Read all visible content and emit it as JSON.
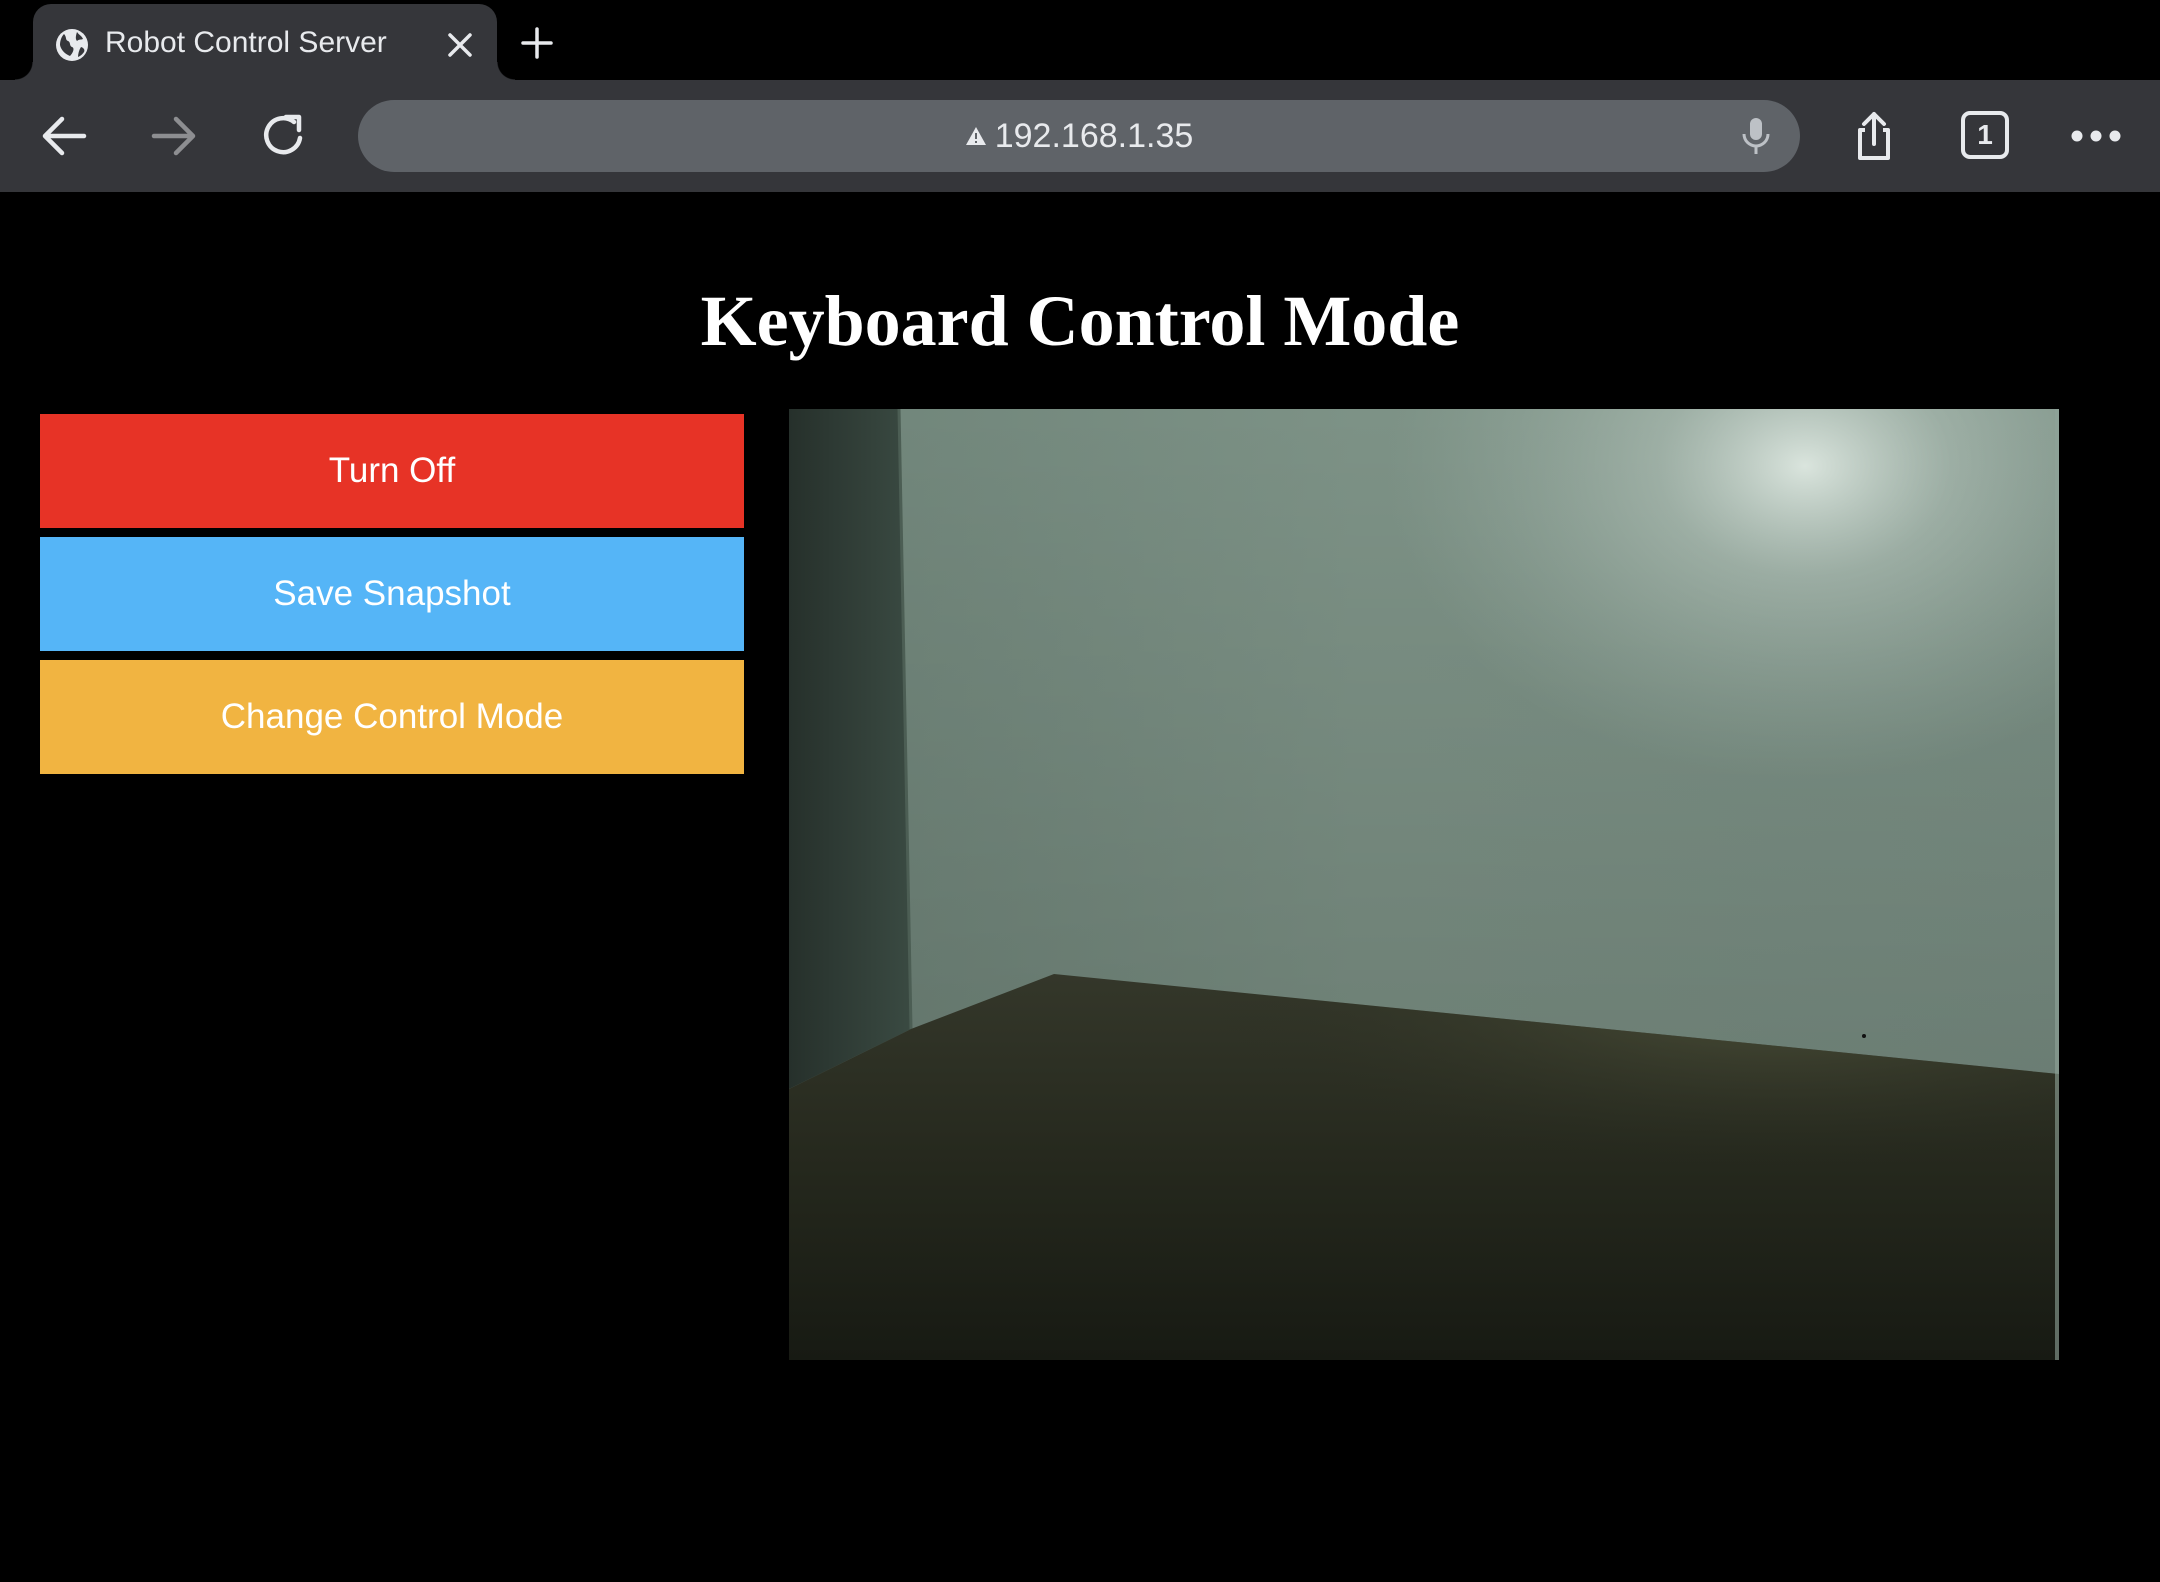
{
  "browser": {
    "tab": {
      "title": "Robot Control Server",
      "favicon_icon": "globe-icon",
      "close_icon": "close-icon"
    },
    "new_tab_icon": "plus-icon",
    "toolbar": {
      "back_icon": "back-arrow-icon",
      "forward_icon": "forward-arrow-icon",
      "reload_icon": "reload-icon",
      "url": "192.168.1.35",
      "security_icon": "warning-triangle-icon",
      "mic_icon": "microphone-icon",
      "share_icon": "share-icon",
      "tab_count": "1",
      "menu_icon": "more-horizontal-icon"
    }
  },
  "page": {
    "title": "Keyboard Control Mode",
    "buttons": [
      {
        "label": "Turn Off",
        "color": "#e73326"
      },
      {
        "label": "Save Snapshot",
        "color": "#55b5f7"
      },
      {
        "label": "Change Control Mode",
        "color": "#f1b441"
      }
    ],
    "camera_feed": "camera-feed"
  },
  "colors": {
    "background": "#000000",
    "chrome": "#35363a",
    "omnibox": "#5f6368",
    "chrome_text": "#e8eaed"
  }
}
